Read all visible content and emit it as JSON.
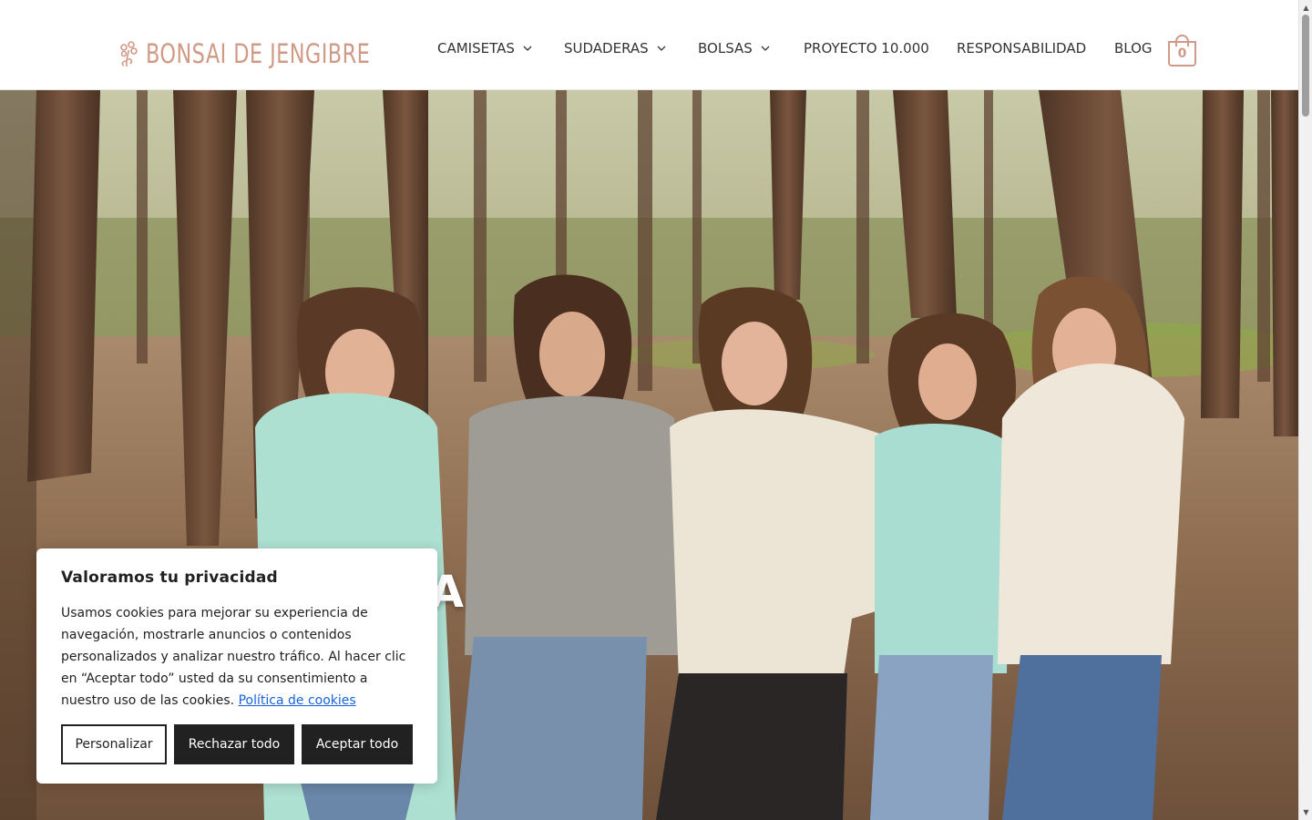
{
  "brand": {
    "name": "BONSAI DE JENGIBRE",
    "color": "#d19a86"
  },
  "nav": {
    "items": [
      {
        "label": "CAMISETAS",
        "has_dropdown": true
      },
      {
        "label": "SUDADERAS",
        "has_dropdown": true
      },
      {
        "label": "BOLSAS",
        "has_dropdown": true
      },
      {
        "label": "PROYECTO 10.000",
        "has_dropdown": false
      },
      {
        "label": "RESPONSABILIDAD",
        "has_dropdown": false
      },
      {
        "label": "BLOG",
        "has_dropdown": false
      }
    ],
    "cart_count": "0",
    "cart_icon": "shopping-bag-icon",
    "dropdown_icon": "chevron-down-icon"
  },
  "hero": {
    "title_partial": "PA",
    "image_description_icon": "hero-photo"
  },
  "cookie_banner": {
    "title": "Valoramos tu privacidad",
    "body": "Usamos cookies para mejorar su experiencia de navegación, mostrarle anuncios o contenidos personalizados y analizar nuestro tráfico. Al hacer clic en “Aceptar todo” usted da su consentimiento a nuestro uso de las cookies.",
    "policy_link": "Política de cookies",
    "buttons": {
      "customize": "Personalizar",
      "reject": "Rechazar todo",
      "accept": "Aceptar todo"
    },
    "link_color": "#1863dc",
    "button_color": "#212121"
  }
}
